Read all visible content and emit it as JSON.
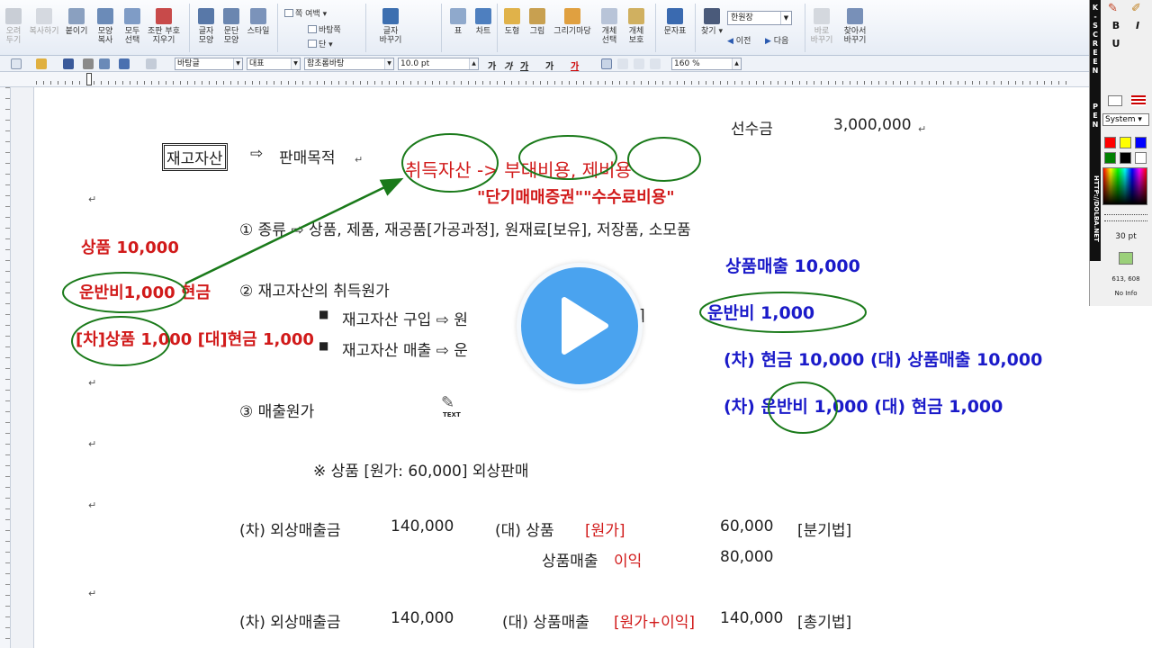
{
  "ribbon": {
    "buttons": [
      {
        "l1": "오려",
        "l2": "두기",
        "disabled": true
      },
      {
        "l1": "복사하기",
        "l2": "",
        "disabled": true
      },
      {
        "l1": "붙이기",
        "l2": "",
        "disabled": false
      },
      {
        "l1": "모양",
        "l2": "복사",
        "disabled": false
      },
      {
        "l1": "모두",
        "l2": "선택",
        "disabled": false
      },
      {
        "l1": "조판 부호",
        "l2": "지우기",
        "disabled": false
      },
      {
        "l1": "글자",
        "l2": "모양",
        "disabled": false
      },
      {
        "l1": "문단",
        "l2": "모양",
        "disabled": false
      },
      {
        "l1": "스타일",
        "l2": "",
        "disabled": false
      },
      {
        "l1": "글자",
        "l2": "바꾸기",
        "disabled": false
      },
      {
        "l1": "표",
        "l2": "",
        "disabled": false
      },
      {
        "l1": "차트",
        "l2": "",
        "disabled": false
      },
      {
        "l1": "도형",
        "l2": "",
        "disabled": false
      },
      {
        "l1": "그림",
        "l2": "",
        "disabled": false
      },
      {
        "l1": "그리기마당",
        "l2": "",
        "disabled": false
      },
      {
        "l1": "개체",
        "l2": "선택",
        "disabled": false
      },
      {
        "l1": "개체",
        "l2": "보호",
        "disabled": false
      },
      {
        "l1": "문자표",
        "l2": "",
        "disabled": false
      },
      {
        "l1": "찾기",
        "l2": "",
        "disabled": false
      },
      {
        "l1": "바로",
        "l2": "바꾸기",
        "disabled": true
      },
      {
        "l1": "찾아서",
        "l2": "바꾸기",
        "disabled": false
      }
    ],
    "small": {
      "margin": "쪽 여백",
      "background": "바탕쪽",
      "column": "단"
    },
    "find_select": "한원장",
    "prev": "이전",
    "next": "다음"
  },
  "formatbar": {
    "style": "바탕글",
    "lang": "대표",
    "font": "함초롬바탕",
    "size": "10.0",
    "size_unit": "pt",
    "bold": "가",
    "italic": "가",
    "underline": "가",
    "strike": "가",
    "color": "가",
    "line_spacing": "160",
    "line_unit": "%"
  },
  "doc": {
    "advance_label": "선수금",
    "advance_value": "3,000,000",
    "inventory": "재고자산",
    "arrow": "⇨",
    "sale_purpose": "판매목적",
    "acq_text": "취득자산 -> 부대비용, 제비용",
    "fee_text": "\"단기매매증권\"\"수수료비용\"",
    "item1": "① 종류 ⇨ 상품, 제품, 재공품[가공과정], 원재료[보유], 저장품, 소모품",
    "goods": "상품 10,000",
    "freight": "운반비1,000 현금",
    "journal_left": "[차]상품 1,000 [대]현금 1,000",
    "item2": "② 재고자산의 취득원가",
    "bullet1": "재고자산 구입 ⇨ 원",
    "bullet1_end": "]",
    "bullet2": "재고자산 매출 ⇨ 운",
    "item3": "③ 매출원가",
    "text_cursor": "TEXT",
    "note": "※ 상품 [원가: 60,000] 외상판매",
    "row1_dr": "(차) 외상매출금",
    "row1_amt": "140,000",
    "row1_cr": "(대) 상품",
    "row1_cost": "[원가]",
    "row1_val": "60,000",
    "row1_method": "[분기법]",
    "row2_item": "상품매출",
    "row2_profit": "이익",
    "row2_val": "80,000",
    "row3_dr": "(차) 외상매출금",
    "row3_amt": "140,000",
    "row3_cr": "(대) 상품매출",
    "row3_mid": "[원가+이익]",
    "row3_val": "140,000",
    "row3_method": "[총기법]",
    "right_sales": "상품매출 10,000",
    "right_freight": "운반비 1,000",
    "right_journal1": "(차) 현금 10,000 (대) 상품매출 10,000",
    "right_journal2": "(차) 운반비 1,000 (대) 현금 1,000",
    "para_mark": "↵"
  },
  "penpanel": {
    "vertical": [
      "K",
      "-",
      "S",
      "C",
      "R",
      "E",
      "E",
      "N",
      " ",
      "P",
      "E",
      "N"
    ],
    "url": "HTTP://DOLBA.NET",
    "bold": "B",
    "italic": "I",
    "underline": "U",
    "font_select": "System",
    "size": "30 pt",
    "coords": "613, 608",
    "info": "No Info",
    "colors": [
      "#ff0000",
      "#ffff00",
      "#0000ff",
      "#008000",
      "#000000",
      "#ffffff"
    ]
  },
  "colors": {
    "annotation_red": "#d11a1a",
    "annotation_blue": "#1a1ac9",
    "annotation_green": "#1a7a1a",
    "play_button": "#4aa3ef"
  }
}
